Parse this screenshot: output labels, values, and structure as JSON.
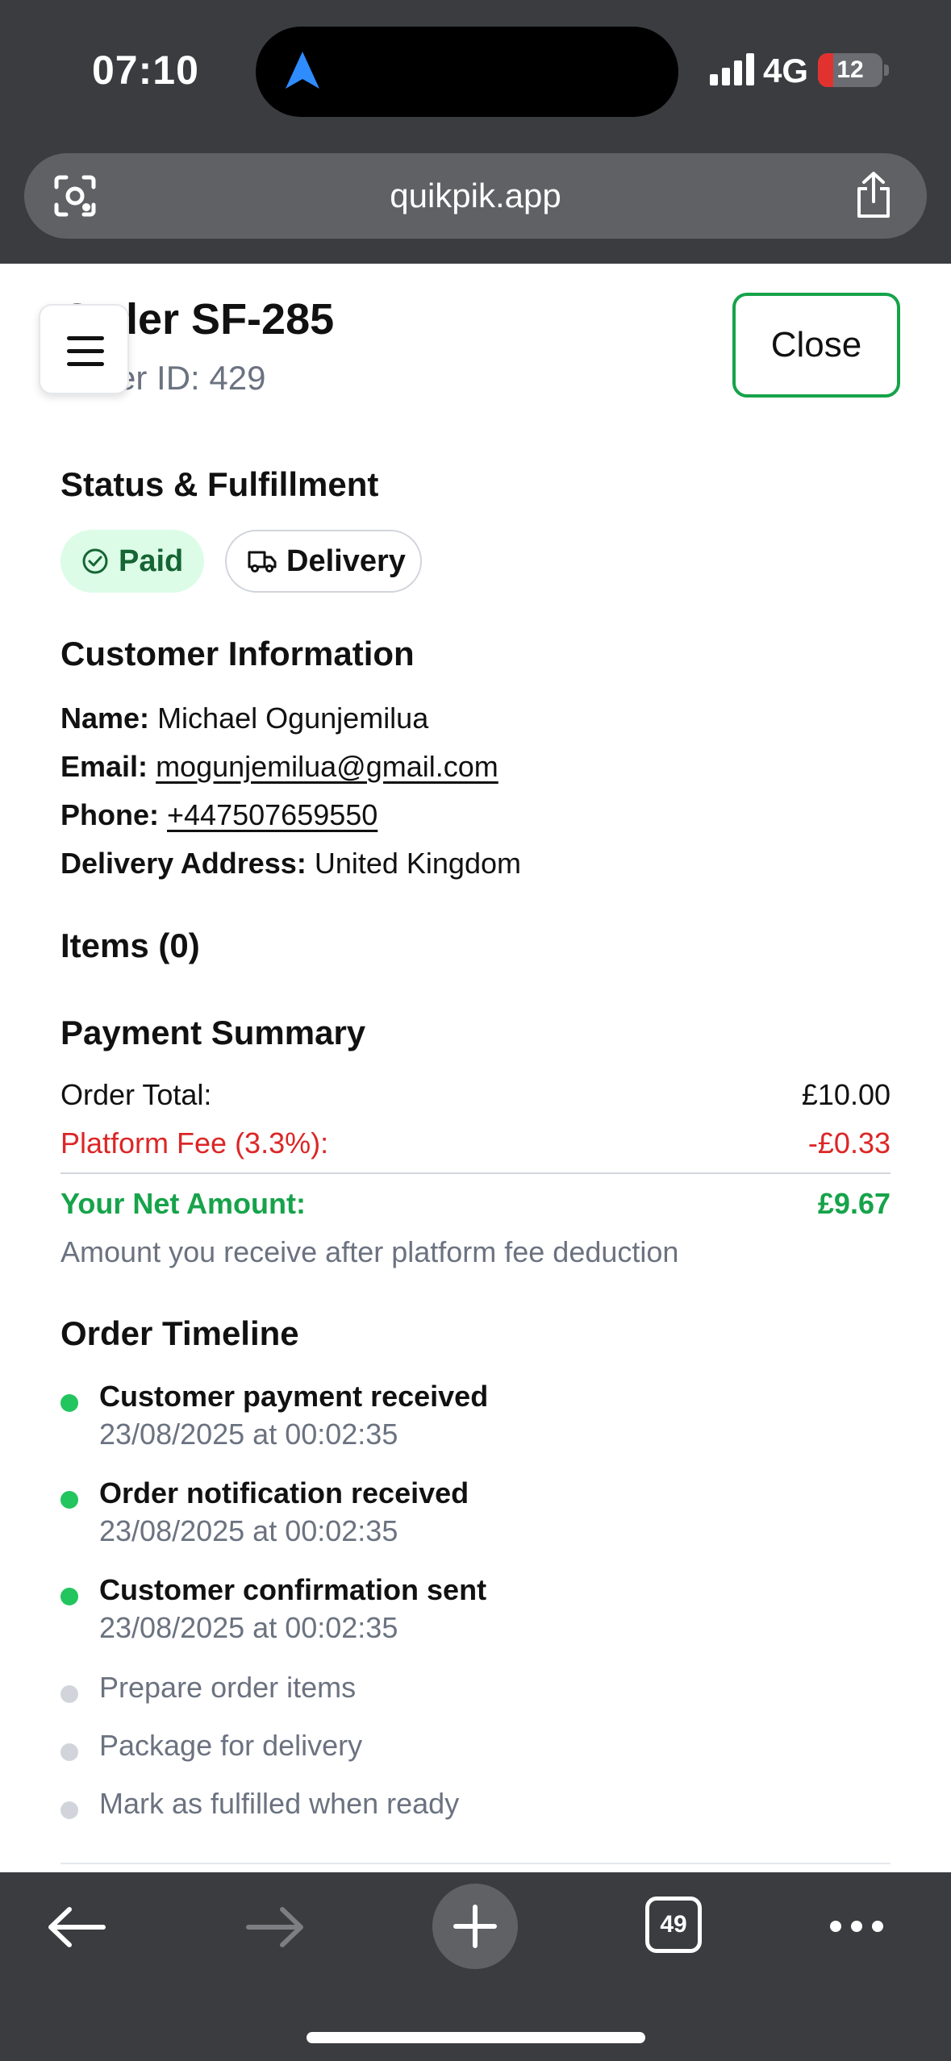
{
  "status_bar": {
    "time": "07:10",
    "network": "4G",
    "battery": "12",
    "battery_level": 0.12
  },
  "browser": {
    "url": "quikpik.app",
    "tab_count": "49"
  },
  "header": {
    "title": "Order SF-285",
    "order_id": "Order ID: 429",
    "close_label": "Close"
  },
  "status": {
    "heading": "Status & Fulfillment",
    "payment_badge": "Paid",
    "method_badge": "Delivery"
  },
  "customer": {
    "heading": "Customer Information",
    "name_label": "Name:",
    "name": "Michael Ogunjemilua",
    "email_label": "Email:",
    "email": "mogunjemilua@gmail.com",
    "phone_label": "Phone:",
    "phone": "+447507659550",
    "address_label": "Delivery Address:",
    "address": "United Kingdom"
  },
  "items": {
    "heading": "Items (0)"
  },
  "payment": {
    "heading": "Payment Summary",
    "total_label": "Order Total:",
    "total_value": "£10.00",
    "fee_label": "Platform Fee (3.3%):",
    "fee_value": "-£0.33",
    "net_label": "Your Net Amount:",
    "net_value": "£9.67",
    "note": "Amount you receive after platform fee deduction"
  },
  "timeline": {
    "heading": "Order Timeline",
    "events": [
      {
        "label": "Customer payment received",
        "time": "23/08/2025 at 00:02:35",
        "done": true
      },
      {
        "label": "Order notification received",
        "time": "23/08/2025 at 00:02:35",
        "done": true
      },
      {
        "label": "Customer confirmation sent",
        "time": "23/08/2025 at 00:02:35",
        "done": true
      },
      {
        "label": "Prepare order items",
        "done": false
      },
      {
        "label": "Package for delivery",
        "done": false
      },
      {
        "label": "Mark as fulfilled when ready",
        "done": false
      }
    ]
  },
  "colors": {
    "accent_green": "#16a34a",
    "fee_red": "#dc2626",
    "net_green": "#16a34a"
  }
}
